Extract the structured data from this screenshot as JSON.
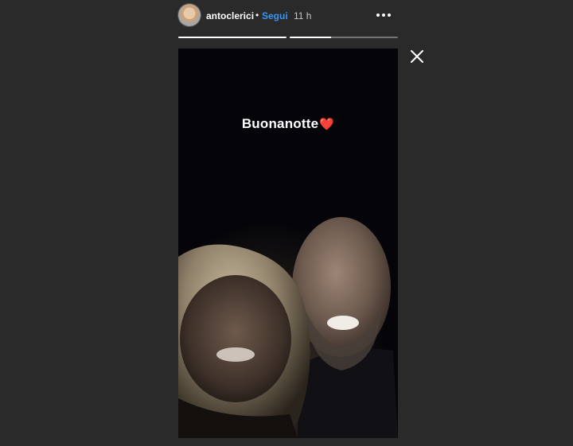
{
  "story": {
    "username": "antoclerici",
    "separator": "•",
    "follow_label": "Segui",
    "time_ago": "11 h",
    "caption_text": "Buonanotte",
    "caption_emoji": "❤️",
    "progress": [
      1.0,
      0.38
    ]
  },
  "icons": {
    "avatar": "avatar",
    "more": "more-options-icon",
    "close": "close-icon",
    "heart": "heart-emoji"
  },
  "colors": {
    "background": "#2a2a2a",
    "follow": "#3897f0",
    "text": "#ffffff",
    "time": "#c7c7c7"
  }
}
